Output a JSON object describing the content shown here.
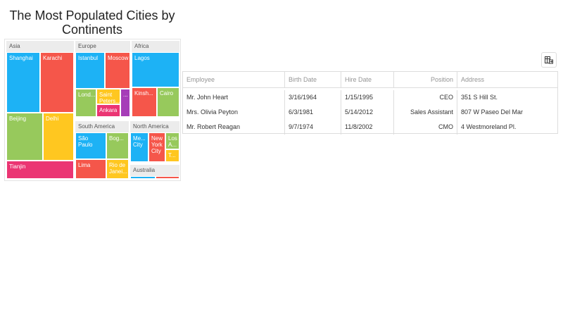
{
  "chart": {
    "title": "The Most Populated Cities by Continents"
  },
  "chart_data": {
    "type": "treemap",
    "groups": [
      {
        "name": "Asia",
        "cities": [
          "Shanghai",
          "Karachi",
          "Beijing",
          "Delhi",
          "Tianjin"
        ]
      },
      {
        "name": "Europe",
        "cities": [
          "Istanbul",
          "Moscow",
          "Lond...",
          "Saint Peters...",
          "...",
          "Ankara"
        ]
      },
      {
        "name": "Africa",
        "cities": [
          "Lagos",
          "Kinsh...",
          "Cairo"
        ]
      },
      {
        "name": "South America",
        "cities": [
          "São Paulo",
          "Bog...",
          "Lima",
          "Rio de Janei..."
        ]
      },
      {
        "name": "North America",
        "cities": [
          "Me... City",
          "New York City",
          "Los A...",
          "T..."
        ]
      },
      {
        "name": "Australia",
        "cities": []
      }
    ]
  },
  "grid": {
    "columns": [
      "Employee",
      "Birth Date",
      "Hire Date",
      "Position",
      "Address"
    ],
    "rows": [
      [
        "Mr. John Heart",
        "3/16/1964",
        "1/15/1995",
        "CEO",
        "351 S Hill St."
      ],
      [
        "Mrs. Olivia Peyton",
        "6/3/1981",
        "5/14/2012",
        "Sales Assistant",
        "807 W Paseo Del Mar"
      ],
      [
        "Mr. Robert Reagan",
        "9/7/1974",
        "11/8/2002",
        "CMO",
        "4 Westmoreland Pl."
      ]
    ]
  },
  "toolbar": {
    "export_icon": "export-to-excel-icon"
  }
}
